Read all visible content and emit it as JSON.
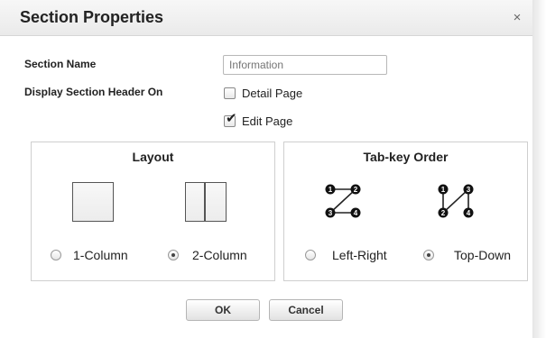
{
  "dialog": {
    "title": "Section Properties",
    "close_glyph": "×"
  },
  "form": {
    "section_name_label": "Section Name",
    "section_name_placeholder": "Information",
    "display_header_label": "Display Section Header On",
    "options": [
      {
        "label": "Detail Page",
        "checked": false
      },
      {
        "label": "Edit Page",
        "checked": true
      }
    ]
  },
  "layout": {
    "title": "Layout",
    "options": [
      {
        "label": "1-Column",
        "selected": false
      },
      {
        "label": "2-Column",
        "selected": true
      }
    ]
  },
  "tab_order": {
    "title": "Tab-key Order",
    "options": [
      {
        "label": "Left-Right",
        "selected": false
      },
      {
        "label": "Top-Down",
        "selected": true
      }
    ],
    "left_right_nodes": [
      "1",
      "2",
      "3",
      "4"
    ],
    "top_down_nodes": [
      "1",
      "3",
      "2",
      "4"
    ]
  },
  "buttons": {
    "ok_label": "OK",
    "cancel_label": "Cancel"
  }
}
